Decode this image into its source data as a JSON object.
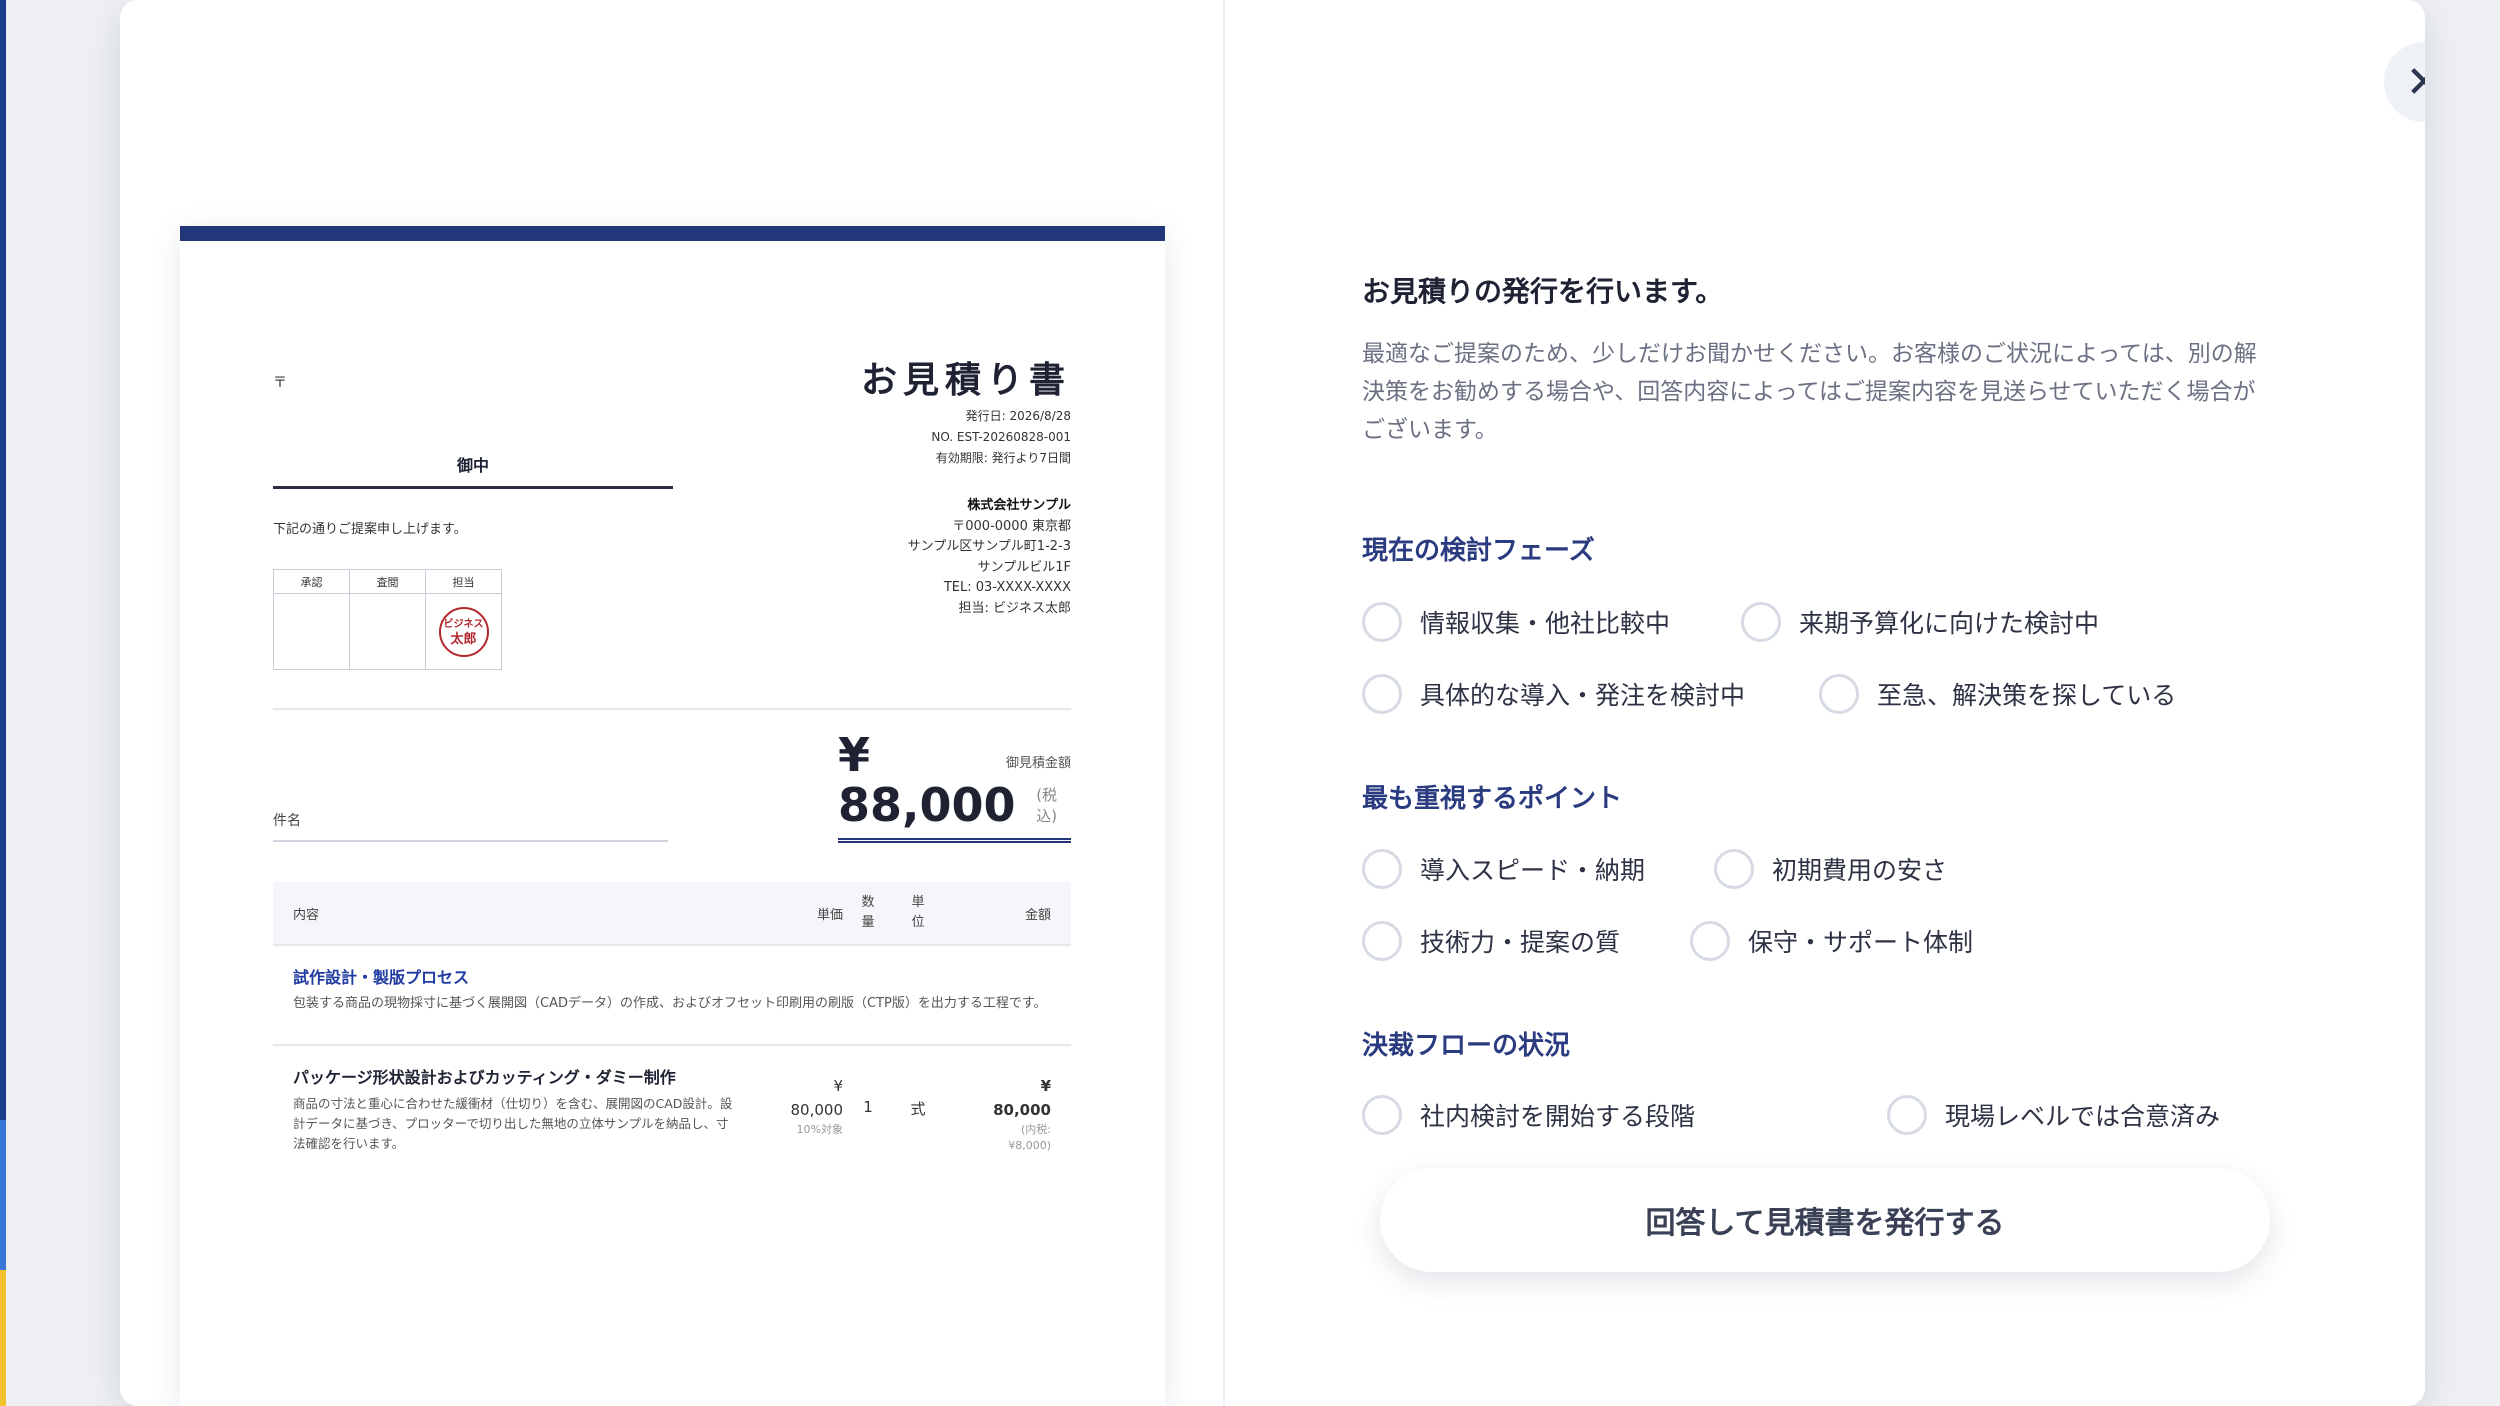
{
  "document": {
    "postal_mark": "〒",
    "addressee_suffix": "御中",
    "intro": "下記の通りご提案申し上げます。",
    "approval_headers": [
      "承認",
      "査閲",
      "担当"
    ],
    "stamp_text": [
      "ビジネス",
      "太郎"
    ],
    "title": "お見積り書",
    "meta": [
      "発行日: 2026/8/28",
      "NO. EST-20260828-001",
      "有効期限: 発行より7日間"
    ],
    "issuer": {
      "name": "株式会社サンプル",
      "lines": [
        "〒000-0000 東京都",
        "サンプル区サンプル町1-2-3",
        "サンプルビル1F",
        "TEL: 03-XXXX-XXXX",
        "担当: ビジネス太郎"
      ]
    },
    "total_label": "御見積金額",
    "subject_label": "件名",
    "total_amount": "¥ 88,000",
    "total_tax_note": "(税込)",
    "table": {
      "headers": {
        "desc": "内容",
        "unit_price": "単価",
        "qty": "数量",
        "unit": "単位",
        "amount": "金額"
      },
      "row1": {
        "title": "試作設計・製版プロセス",
        "description": "包装する商品の現物採寸に基づく展開図（CADデータ）の作成、およびオフセット印刷用の刷版（CTP版）を出力する工程です。"
      },
      "row2": {
        "title": "パッケージ形状設計およびカッティング・ダミー制作",
        "description": "商品の寸法と重心に合わせた緩衝材（仕切り）を含む、展開図のCAD設計。設計データに基づき、プロッターで切り出した無地の立体サンプルを納品し、寸法確認を行います。",
        "unit_price_symbol": "¥",
        "unit_price": "80,000",
        "unit_price_note": "10%対象",
        "qty": "1",
        "unit": "式",
        "amount_symbol": "¥",
        "amount": "80,000",
        "amount_note_1": "(内税:",
        "amount_note_2": "¥8,000)"
      }
    }
  },
  "form": {
    "close_label": "✕",
    "heading": "お見積りの発行を行います。",
    "description": "最適なご提案のため、少しだけお聞かせください。お客様のご状況によっては、別の解決策をお勧めする場合や、回答内容によってはご提案内容を見送らせていただく場合がございます。",
    "sections": [
      {
        "title": "現在の検討フェーズ",
        "options": [
          "情報収集・他社比較中",
          "来期予算化に向けた検討中",
          "具体的な導入・発注を検討中",
          "至急、解決策を探している"
        ]
      },
      {
        "title": "最も重視するポイント",
        "options": [
          "導入スピード・納期",
          "初期費用の安さ",
          "技術力・提案の質",
          "保守・サポート体制"
        ]
      },
      {
        "title": "決裁フローの状況",
        "options": [
          "社内検討を開始する段階",
          "現場レベルでは合意済み"
        ]
      }
    ],
    "submit_label": "回答して見積書を発行する"
  }
}
